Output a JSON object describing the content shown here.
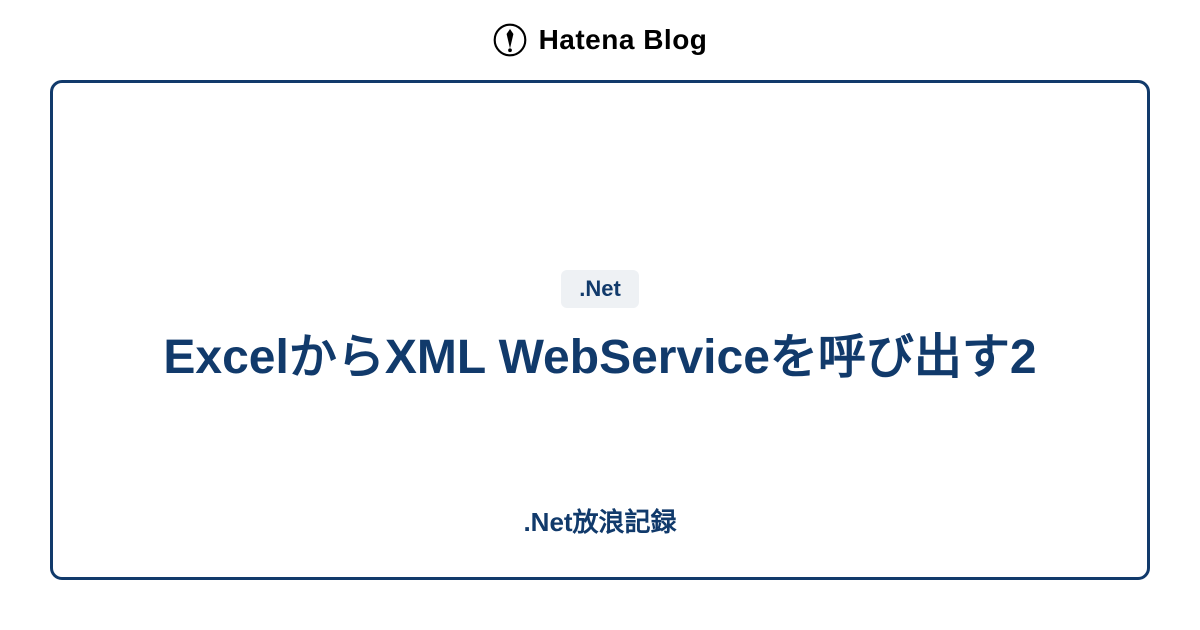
{
  "header": {
    "brand": "Hatena Blog"
  },
  "card": {
    "category": ".Net",
    "title": "ExcelからXML WebServiceを呼び出す2",
    "blog_name": ".Net放浪記録"
  }
}
